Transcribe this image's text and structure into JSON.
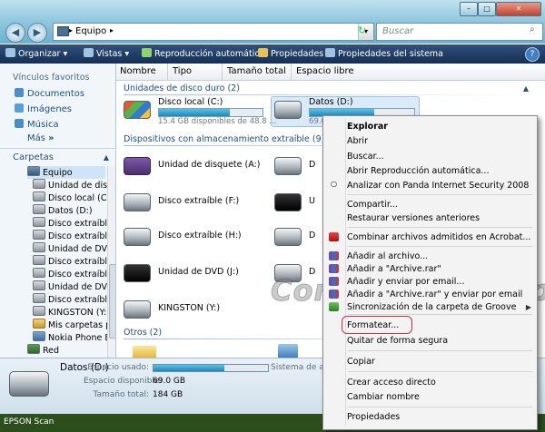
{
  "window": {
    "controls": {
      "minimize": "–",
      "maximize": "□",
      "close": "✕"
    },
    "back_glyph": "◀",
    "forward_glyph": "▶",
    "address": {
      "crumb": "Equipo",
      "sep": "▸"
    },
    "refresh_glyph": "↻",
    "search_placeholder": "Buscar"
  },
  "toolbar": {
    "organize": "Organizar",
    "views": "Vistas",
    "autoplay": "Reproducción automática",
    "properties": "Propiedades",
    "system_properties": "Propiedades del sistema",
    "dropdown_glyph": "▾",
    "help": "?"
  },
  "nav": {
    "favorites_title": "Vínculos favoritos",
    "favorites": [
      "Documentos",
      "Imágenes",
      "Música"
    ],
    "more": "Más",
    "more_glyph": "»",
    "folders_title": "Carpetas",
    "folders_glyph": "▲",
    "tree": [
      "Equipo",
      "Unidad de disc",
      "Disco local (C:",
      "Datos (D:)",
      "Disco extraíble",
      "Disco extraíble",
      "Unidad de DVD",
      "Disco extraíble",
      "Disco extraíble",
      "Unidad de DVD",
      "Disco extraíble",
      "KINGSTON (Y:)",
      "Mis carpetas p",
      "Nokia Phone B",
      "Red"
    ]
  },
  "columns": [
    "Nombre",
    "Tipo",
    "Tamaño total",
    "Espacio libre"
  ],
  "content": {
    "groups": {
      "hdd": "Unidades de disco duro (2)",
      "removable": "Dispositivos con almacenamiento extraíble (9)",
      "other": "Otros (2)"
    },
    "collapse_glyph": "▲",
    "items": {
      "c_label": "Disco local (C:)",
      "c_sub": "15.4 GB disponibles de 48.8 ...",
      "c_fill": 0.68,
      "d_label": "Datos (D:)",
      "d_sub": "69.0",
      "d_fill": 0.62,
      "floppy": "Unidad de disquete (A:)",
      "f": "Disco extraíble (F:)",
      "h": "Disco extraíble (H:)",
      "dvd": "Unidad de DVD (J:)",
      "kingston": "KINGSTON (Y:)",
      "right_frag_1": "D",
      "right_frag_2": "U",
      "right_frag_3": "D",
      "right_frag_4": "D"
    }
  },
  "details": {
    "name": "Datos (D:)",
    "used_label": "Espacio usado:",
    "used_fill": 0.62,
    "fs_frag": "Sistema de arch",
    "free_label": "Espacio disponible:",
    "free_value": "69.0 GB",
    "total_label": "Tamaño total:",
    "total_value": "184 GB"
  },
  "desktop_label": "EPSON Scan",
  "watermark": "ConfigurarEquipos",
  "context_menu": {
    "explore": "Explorar",
    "open": "Abrir",
    "search": "Buscar...",
    "autoplay": "Abrir Reproducción automática...",
    "panda": "Analizar con Panda Internet Security 2008",
    "share": "Compartir...",
    "restore": "Restaurar versiones anteriores",
    "acrobat": "Combinar archivos admitidos en Acrobat...",
    "add_archive": "Añadir al archivo...",
    "add_rar": "Añadir a \"Archive.rar\"",
    "add_email": "Añadir y enviar por email...",
    "add_rar_email": "Añadir a \"Archive.rar\" y enviar por email",
    "groove": "Sincronización de la carpeta de Groove",
    "submenu_glyph": "▶",
    "format": "Formatear...",
    "eject": "Quitar de forma segura",
    "copy": "Copiar",
    "shortcut": "Crear acceso directo",
    "rename": "Cambiar nombre",
    "properties": "Propiedades",
    "colors": {
      "accent": "#c5344a"
    }
  }
}
